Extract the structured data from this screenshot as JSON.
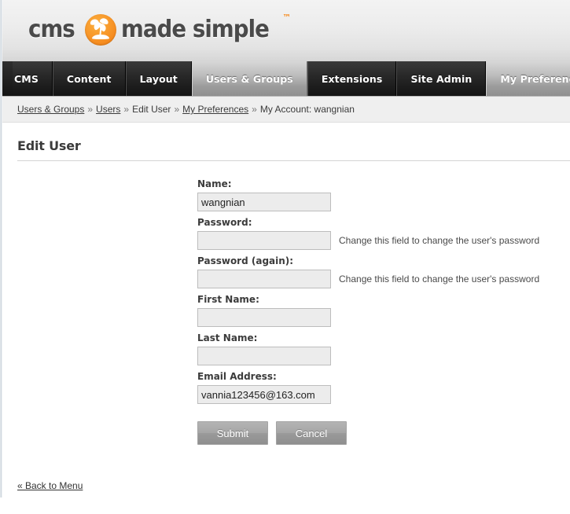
{
  "brand": {
    "word1": "cms",
    "word2": "made simple",
    "tm": "™",
    "mark_icon": "palm-tree-island-icon",
    "accent_color": "#f68b1f",
    "text_color": "#4a4a4a"
  },
  "nav": {
    "tabs": [
      {
        "label": "CMS",
        "active": false
      },
      {
        "label": "Content",
        "active": false
      },
      {
        "label": "Layout",
        "active": false
      },
      {
        "label": "Users & Groups",
        "active": true
      },
      {
        "label": "Extensions",
        "active": false
      },
      {
        "label": "Site Admin",
        "active": false
      },
      {
        "label": "My Preferences",
        "active": true
      }
    ]
  },
  "breadcrumb": {
    "separator": "»",
    "items": [
      {
        "label": "Users & Groups",
        "link": true
      },
      {
        "label": "Users",
        "link": true
      },
      {
        "label": "Edit User",
        "link": false
      },
      {
        "label": "My Preferences",
        "link": true
      },
      {
        "label": "My Account: wangnian",
        "link": false
      }
    ]
  },
  "page": {
    "title": "Edit User"
  },
  "form": {
    "fields": [
      {
        "key": "name",
        "label": "Name:",
        "value": "wangnian",
        "placeholder": "",
        "type": "text",
        "hint": ""
      },
      {
        "key": "password",
        "label": "Password:",
        "value": "",
        "placeholder": "",
        "type": "password",
        "hint": "Change this field to change the user's password"
      },
      {
        "key": "password_again",
        "label": "Password (again):",
        "value": "",
        "placeholder": "",
        "type": "password",
        "hint": "Change this field to change the user's password"
      },
      {
        "key": "first_name",
        "label": "First Name:",
        "value": "",
        "placeholder": "",
        "type": "text",
        "hint": ""
      },
      {
        "key": "last_name",
        "label": "Last Name:",
        "value": "",
        "placeholder": "",
        "type": "text",
        "hint": ""
      },
      {
        "key": "email",
        "label": "Email Address:",
        "value": "vannia123456@163.com",
        "placeholder": "",
        "type": "text",
        "hint": ""
      }
    ],
    "submit_label": "Submit",
    "cancel_label": "Cancel"
  },
  "footer": {
    "back_label": "« Back to Menu"
  }
}
